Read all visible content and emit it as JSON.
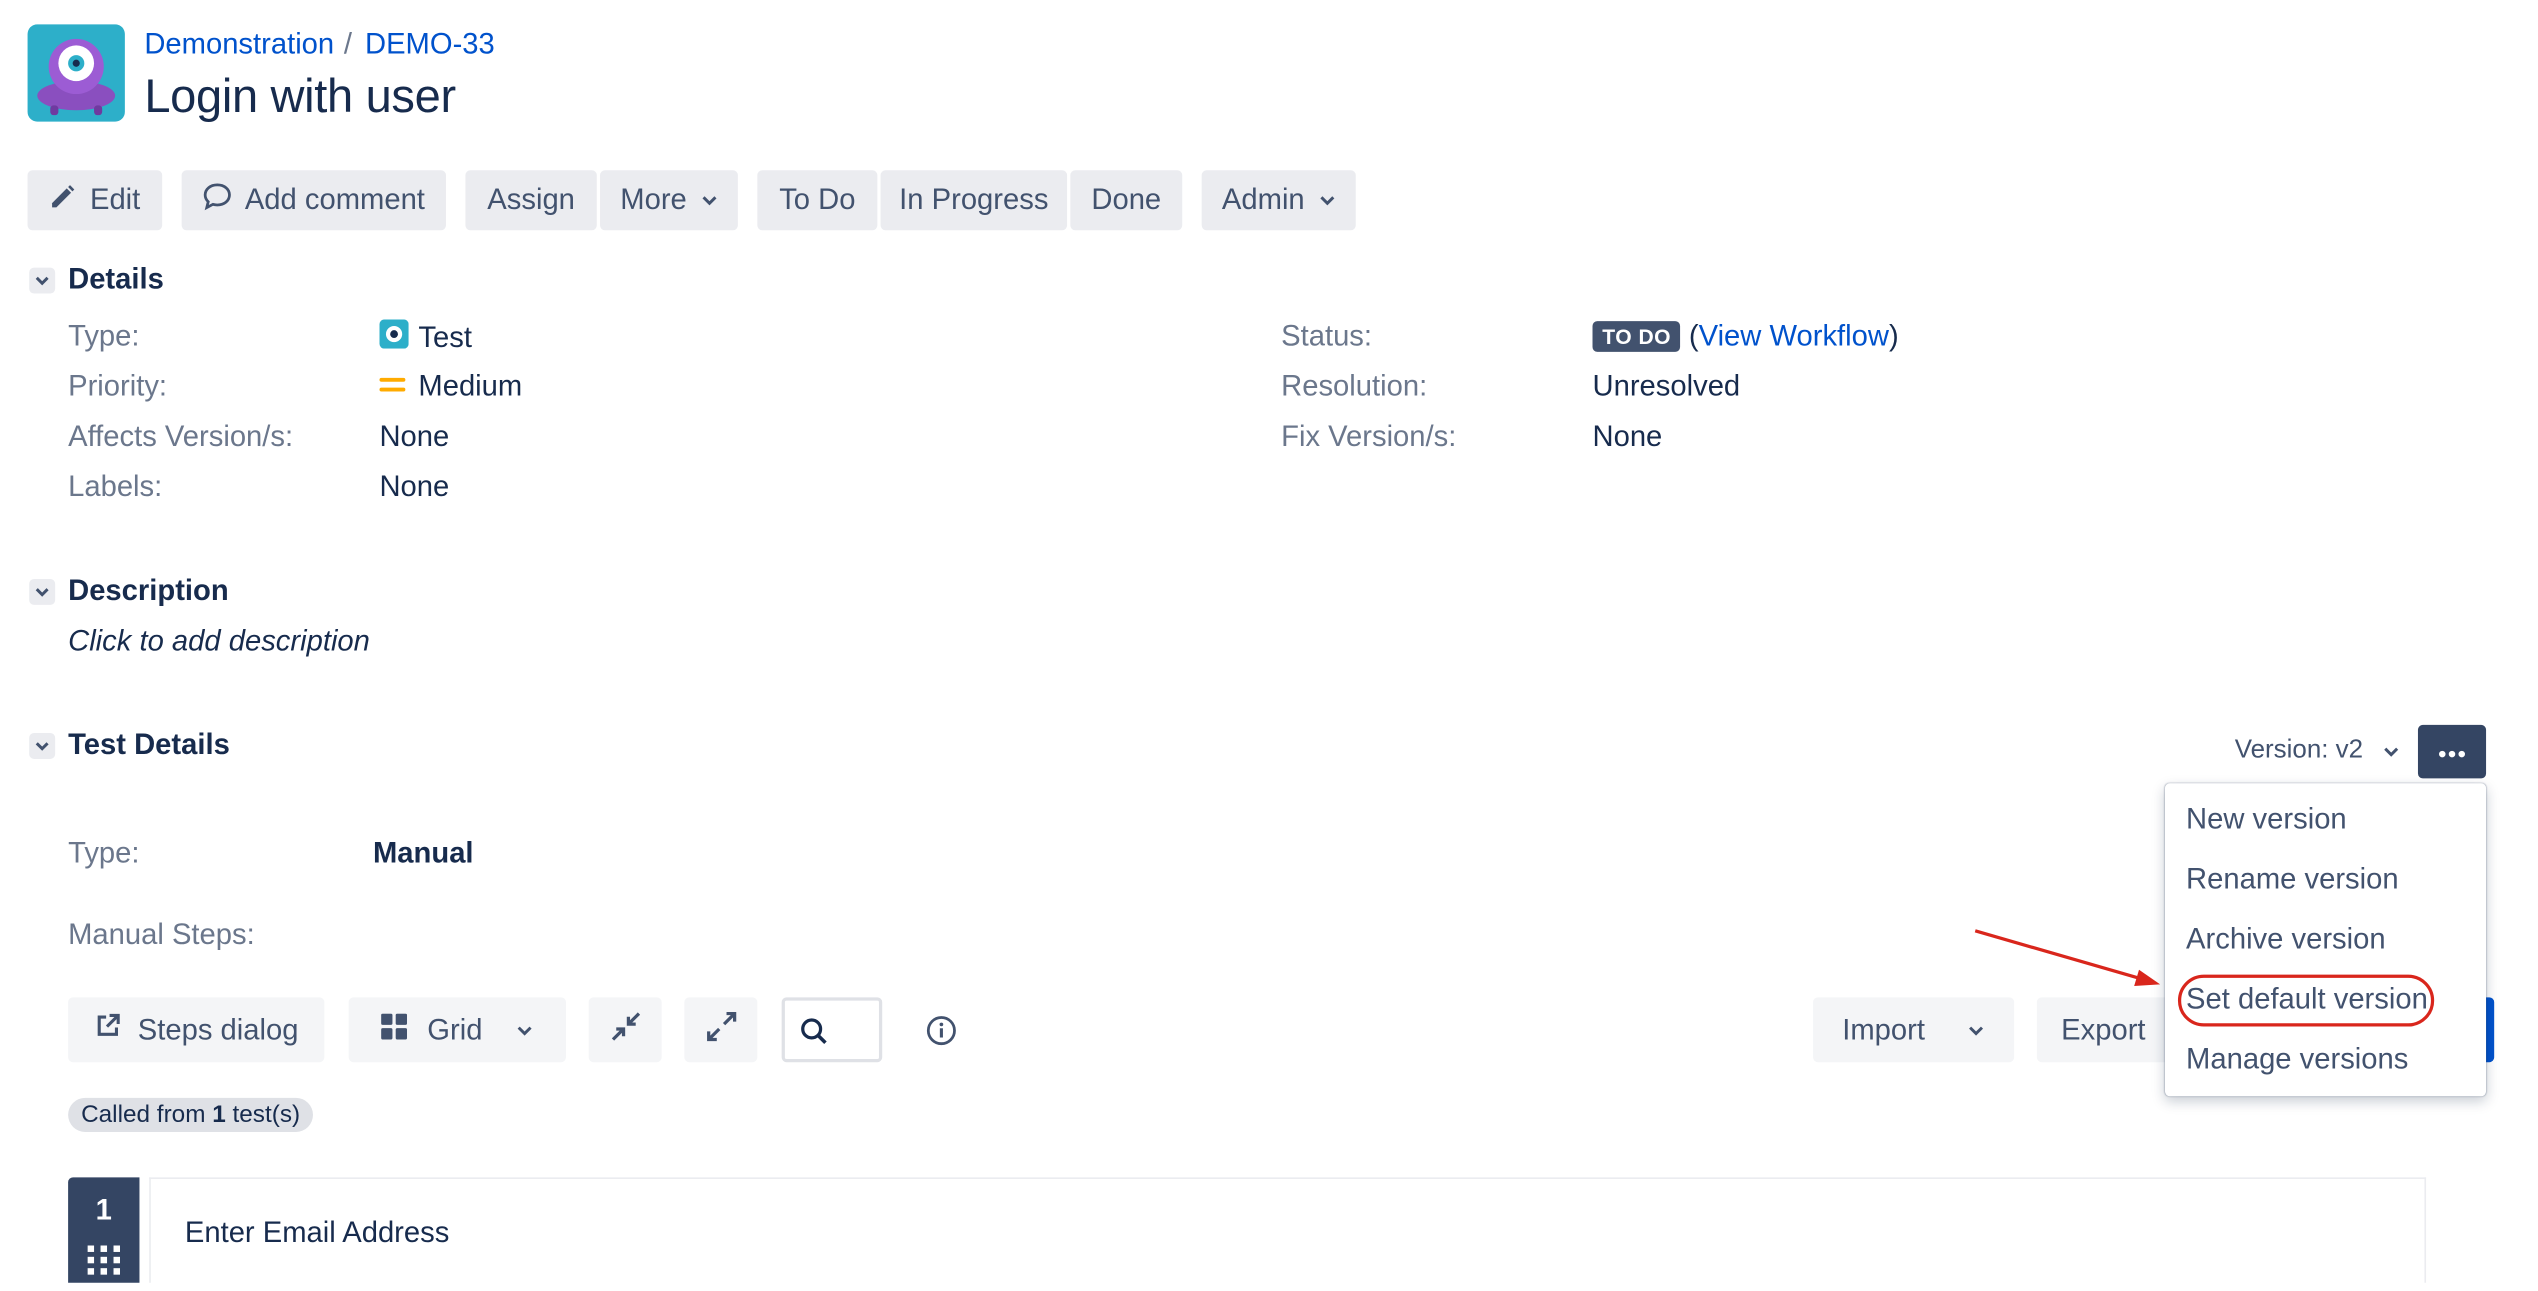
{
  "header": {
    "breadcrumb": {
      "project": "Demonstration",
      "separator": "/",
      "issue_key": "DEMO-33"
    },
    "title": "Login with user"
  },
  "toolbar": {
    "edit": "Edit",
    "add_comment": "Add comment",
    "assign": "Assign",
    "more": "More",
    "to_do": "To Do",
    "in_progress": "In Progress",
    "done": "Done",
    "admin": "Admin"
  },
  "details": {
    "section_title": "Details",
    "type_label": "Type:",
    "type_value": "Test",
    "priority_label": "Priority:",
    "priority_value": "Medium",
    "affects_label": "Affects Version/s:",
    "affects_value": "None",
    "labels_label": "Labels:",
    "labels_value": "None",
    "status_label": "Status:",
    "status_value": "TO DO",
    "view_workflow_open": "(",
    "view_workflow": "View Workflow",
    "view_workflow_close": ")",
    "resolution_label": "Resolution:",
    "resolution_value": "Unresolved",
    "fix_label": "Fix Version/s:",
    "fix_value": "None"
  },
  "description": {
    "section_title": "Description",
    "placeholder": "Click to add description"
  },
  "test_details": {
    "section_title": "Test Details",
    "version_label": "Version: v2",
    "type_label": "Type:",
    "type_value": "Manual",
    "manual_steps_label": "Manual Steps:",
    "version_menu": [
      "New version",
      "Rename version",
      "Archive version",
      "Set default version",
      "Manage versions"
    ]
  },
  "steps_toolbar": {
    "steps_dialog": "Steps dialog",
    "grid": "Grid",
    "import": "Import",
    "export": "Export",
    "called_from_prefix": "Called from ",
    "called_from_count": "1",
    "called_from_suffix": " test(s)"
  },
  "steps": [
    {
      "number": "1",
      "action": "Enter Email Address"
    }
  ],
  "colors": {
    "link": "#0052cc",
    "text": "#172b4d",
    "subtle": "#6b778c",
    "button_bg": "#ebecf0",
    "dark_button": "#344563",
    "annotation_red": "#d9261c",
    "priority_medium": "#ffab00",
    "primary_blue": "#0052cc"
  },
  "icons": [
    "project-avatar-icon",
    "pencil-icon",
    "comment-icon",
    "chevron-down-icon",
    "test-type-icon",
    "priority-medium-icon",
    "ellipsis-icon",
    "external-link-icon",
    "grid-icon",
    "collapse-icon",
    "expand-icon",
    "search-icon",
    "info-icon",
    "drag-handle-icon"
  ]
}
